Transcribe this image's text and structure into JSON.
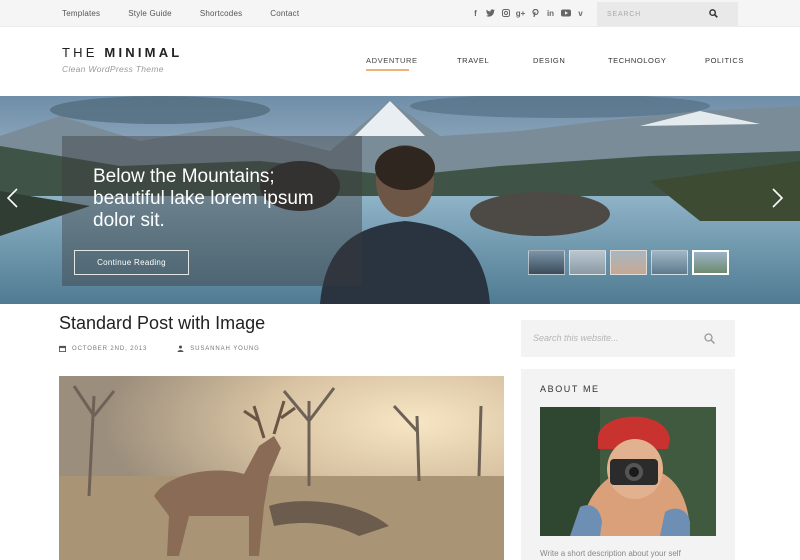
{
  "topbar": {
    "nav": [
      "Templates",
      "Style Guide",
      "Shortcodes",
      "Contact"
    ],
    "socials": [
      "f",
      "t",
      "ig",
      "g+",
      "p",
      "in",
      "yt",
      "v"
    ],
    "search_placeholder": "SEARCH"
  },
  "header": {
    "logo_thin": "THE ",
    "logo_bold": "MINIMAL",
    "tagline": "Clean WordPress Theme",
    "nav": [
      "ADVENTURE",
      "TRAVEL",
      "DESIGN",
      "TECHNOLOGY",
      "POLITICS"
    ],
    "active_nav": "ADVENTURE"
  },
  "hero": {
    "caption": "Below the Mountains; beautiful lake lorem ipsum dolor sit.",
    "button": "Continue Reading",
    "thumbnail_count": 5,
    "active_thumbnail": 5
  },
  "post": {
    "title": "Standard Post with Image",
    "date": "OCTOBER 2ND, 2013",
    "author": "SUSANNAH YOUNG"
  },
  "sidebar": {
    "search_placeholder": "Search this website...",
    "about_title": "ABOUT ME",
    "about_text": "Write a short description about your self"
  },
  "colors": {
    "accent": "#f0b27a",
    "topbar_bg": "#f5f5f5",
    "sidebar_bg": "#f3f3f3"
  }
}
